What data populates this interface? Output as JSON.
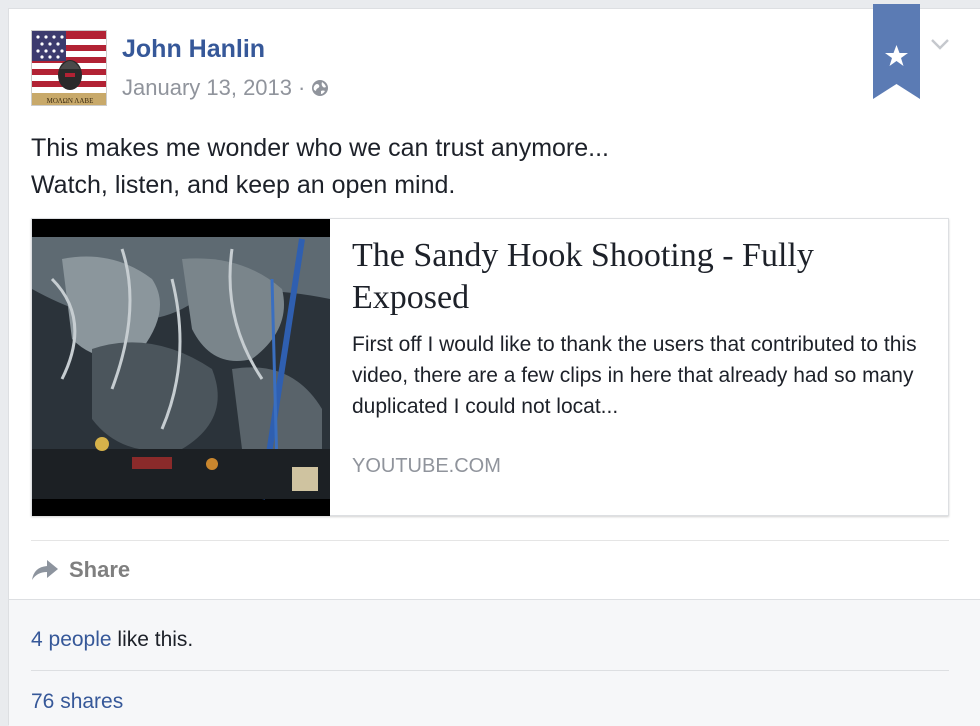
{
  "post": {
    "author": "John Hanlin",
    "date": "January 13, 2013",
    "separator": "·",
    "privacy_icon": "globe-icon",
    "text_line1": "This makes me wonder who we can trust anymore...",
    "text_line2": "Watch, listen, and keep an open mind."
  },
  "link_card": {
    "title": "The Sandy Hook Shooting - Fully Exposed",
    "description": "First off I would like to thank the users that contributed to this video, there are a few clips in here that already had so many duplicated I could not locat...",
    "domain": "YOUTUBE.COM"
  },
  "actions": {
    "share_label": "Share"
  },
  "footer": {
    "likes_link": "4 people",
    "likes_suffix": " like this.",
    "shares": "76 shares"
  },
  "colors": {
    "link_blue": "#365899",
    "bookmark_blue": "#5b7bb4",
    "muted_gray": "#90949c"
  },
  "avatar": {
    "banner_text": "ΜΟΛΩΝ ΛΑΒΕ"
  }
}
